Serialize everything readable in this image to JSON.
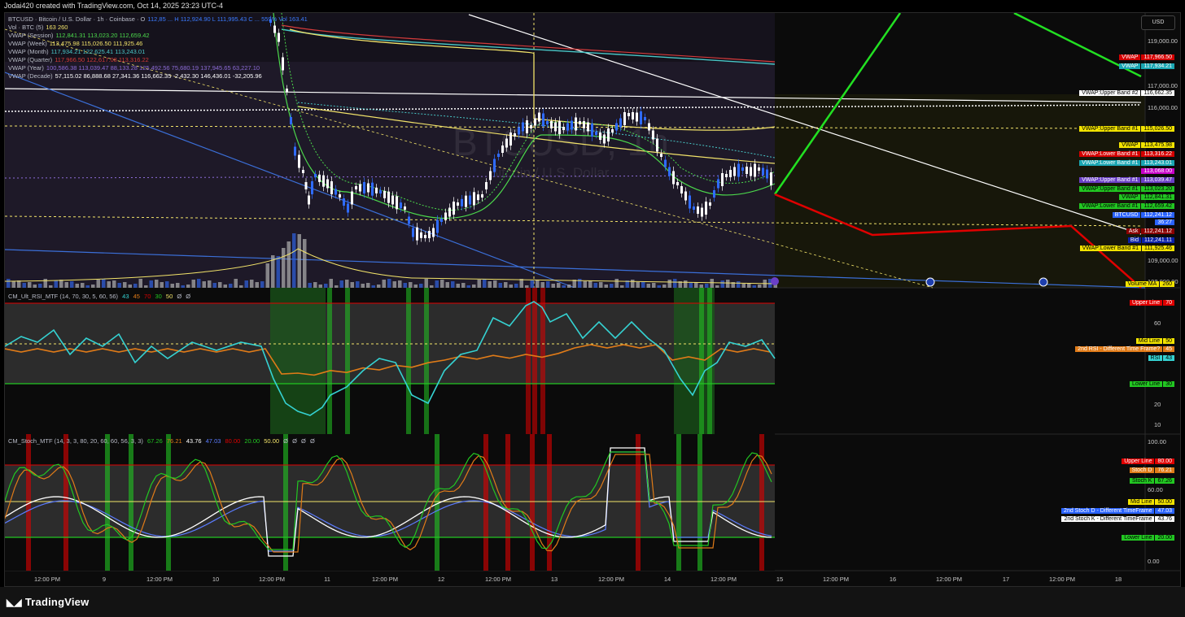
{
  "header": {
    "credit": "Jodai420 created with TradingView.com, Oct 14, 2025 23:23 UTC-4"
  },
  "currency_button": "USD",
  "main_legend": [
    {
      "label": "BTCUSD · Bitcoin / U.S. Dollar · 1h · Coinbase · O",
      "values": "112,85 ... H 112,924.90 L 111,995.43 C ... 559%  Vol 163.41",
      "color": "#b9bcc8"
    },
    {
      "label": "Vol · BTC (5)",
      "values": "163  260",
      "color": "#3a7bff"
    },
    {
      "label": "VWAP (Session)",
      "values": "112,841.31  113,023.20  112,659.42",
      "color": "#4cd94c"
    },
    {
      "label": "VWAP (Week)",
      "values": "113,475.98  115,026.50  111,925.46",
      "color": "#f2e36a"
    },
    {
      "label": "VWAP (Month)",
      "values": "117,934.21  122,625.41  113,243.01",
      "color": "#48c6c6"
    },
    {
      "label": "VWAP (Quarter)",
      "values": "117,966.50  122,617.08  113,316.22",
      "color": "#d43b3b"
    },
    {
      "label": "VWAP (Year)",
      "values": "100,586.38  113,039.47  88,133.28  125,492.56  75,680.19  137,945.65  63,227.10",
      "color": "#8c6bd6"
    },
    {
      "label": "VWAP (Decade)",
      "values": "57,115.02  86,888.68  27,341.36  116,662.35  -2,432.30  146,436.01  -32,205.96",
      "color": "#ffffff"
    }
  ],
  "watermark": {
    "symbol": "BTCUSD, 1h",
    "name": "Bitcoin / U.S. Dollar"
  },
  "price_axis_ticks": [
    "119,000.00",
    "117,000.00",
    "116,000.00",
    "109,000.00",
    "108,000.00"
  ],
  "price_labels": [
    {
      "name": "VWAP",
      "value": "117,966.50",
      "bg": "#d40000",
      "fg": "#ffffff"
    },
    {
      "name": "VWAP",
      "value": "117,934.21",
      "bg": "#1aa6b3",
      "fg": "#ffffff"
    },
    {
      "name": "VWAP:Upper Band #2",
      "value": "116,662.35",
      "bg": "#ffffff",
      "fg": "#000000"
    },
    {
      "name": "VWAP:Upper Band #1",
      "value": "115,026.50",
      "bg": "#f2e300",
      "fg": "#000000"
    },
    {
      "name": "VWAP",
      "value": "113,475.98",
      "bg": "#f2e300",
      "fg": "#000000"
    },
    {
      "name": "VWAP:Lower Band #1",
      "value": "113,316.22",
      "bg": "#d40000",
      "fg": "#ffffff"
    },
    {
      "name": "VWAP:Lower Band #1",
      "value": "113,243.01",
      "bg": "#1aa6b3",
      "fg": "#ffffff"
    },
    {
      "name": "",
      "value": "113,068.00",
      "bg": "#c800c8",
      "fg": "#ffffff"
    },
    {
      "name": "VWAP:Upper Band #1",
      "value": "113,039.47",
      "bg": "#6a3fc7",
      "fg": "#ffffff"
    },
    {
      "name": "VWAP:Upper Band #1",
      "value": "113,023.20",
      "bg": "#22c722",
      "fg": "#000000"
    },
    {
      "name": "VWAP",
      "value": "112,841.31",
      "bg": "#22c722",
      "fg": "#000000"
    },
    {
      "name": "VWAP:Lower Band #1",
      "value": "112,659.42",
      "bg": "#22c722",
      "fg": "#000000"
    },
    {
      "name": "BTCUSD",
      "value": "112,241.12",
      "bg": "#2962ff",
      "fg": "#ffffff"
    },
    {
      "name": "",
      "value": "36:27",
      "bg": "#2962ff",
      "fg": "#ffffff"
    },
    {
      "name": "Ask",
      "value": "112,241.12",
      "bg": "#8a0000",
      "fg": "#ffffff"
    },
    {
      "name": "Bid",
      "value": "112,241.11",
      "bg": "#0a1fa8",
      "fg": "#ffffff"
    },
    {
      "name": "VWAP:Lower Band #1",
      "value": "111,925.46",
      "bg": "#f2e300",
      "fg": "#000000"
    },
    {
      "name": "Volume MA",
      "value": "260",
      "bg": "#f2e300",
      "fg": "#000000"
    }
  ],
  "rsi_panel": {
    "legend": "CM_Ult_RSI_MTF (14, 70, 30, 5, 60, 56)",
    "legend_values": [
      "43",
      "45",
      "70",
      "30",
      "50",
      "Ø",
      "Ø"
    ],
    "axis_ticks": [
      "60",
      "20",
      "10"
    ],
    "labels": [
      {
        "name": "Upper Line",
        "value": "70",
        "bg": "#e00000",
        "fg": "#ffffff"
      },
      {
        "name": "Mid Line",
        "value": "50",
        "bg": "#f2e300",
        "fg": "#000000"
      },
      {
        "name": "2nd RSI - Different Time Frame?",
        "value": "45",
        "bg": "#e07b18",
        "fg": "#ffffff"
      },
      {
        "name": "RSI",
        "value": "43",
        "bg": "#35d2d2",
        "fg": "#000000"
      },
      {
        "name": "Lower Line",
        "value": "30",
        "bg": "#22c722",
        "fg": "#000000"
      }
    ]
  },
  "stoch_panel": {
    "legend": "CM_Stoch_MTF (14, 3, 3, 80, 20, 60, 60, 56, 3, 3)",
    "legend_values": [
      "67.26",
      "76.21",
      "43.76",
      "47.03",
      "80.00",
      "20.00",
      "50.00",
      "Ø",
      "Ø",
      "Ø",
      "Ø"
    ],
    "axis_ticks": [
      "100.00",
      "60.00",
      "0.00"
    ],
    "labels": [
      {
        "name": "Upper Line",
        "value": "80.00",
        "bg": "#e00000",
        "fg": "#ffffff"
      },
      {
        "name": "Stoch D",
        "value": "76.21",
        "bg": "#e07b18",
        "fg": "#ffffff"
      },
      {
        "name": "Stoch K",
        "value": "67.26",
        "bg": "#22c722",
        "fg": "#000000"
      },
      {
        "name": "Mid Line",
        "value": "50.00",
        "bg": "#f2e300",
        "fg": "#000000"
      },
      {
        "name": "2nd Stoch D - Different TimeFrame",
        "value": "47.03",
        "bg": "#2962ff",
        "fg": "#ffffff"
      },
      {
        "name": "2nd Stoch K - Different TimeFrame",
        "value": "43.76",
        "bg": "#ffffff",
        "fg": "#000000"
      },
      {
        "name": "Lower Line",
        "value": "20.00",
        "bg": "#22c722",
        "fg": "#000000"
      }
    ]
  },
  "time_axis": [
    "12:00 PM",
    "9",
    "12:00 PM",
    "10",
    "12:00 PM",
    "11",
    "12:00 PM",
    "12",
    "12:00 PM",
    "13",
    "12:00 PM",
    "14",
    "12:00 PM",
    "15",
    "12:00 PM",
    "16",
    "12:00 PM",
    "17",
    "12:00 PM",
    "18"
  ],
  "footer": {
    "brand": "TradingView",
    "logo_icon": "tradingview-logo-icon"
  },
  "colors": {
    "up": "#ffffff",
    "down": "#2f6bff",
    "rsi": "#35d2d2",
    "rsi2": "#e07b18",
    "stoch_k": "#22c722",
    "stoch_d": "#e07b18"
  }
}
